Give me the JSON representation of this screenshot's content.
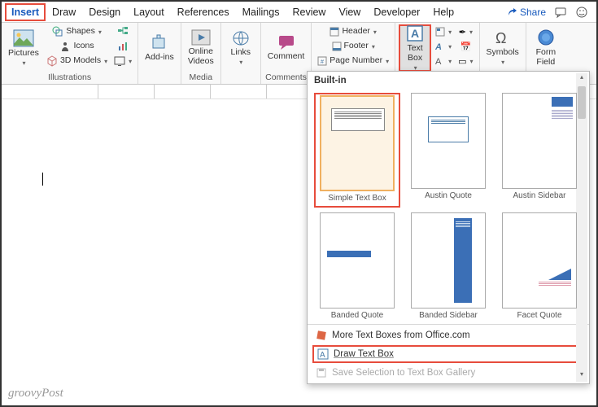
{
  "tabs": {
    "items": [
      "Insert",
      "Draw",
      "Design",
      "Layout",
      "References",
      "Mailings",
      "Review",
      "View",
      "Developer",
      "Help"
    ],
    "active": "Insert"
  },
  "topright": {
    "share": "Share",
    "comments_tooltip": "Comments",
    "smiley_tooltip": "Feedback"
  },
  "ribbon": {
    "illustrations": {
      "label": "Illustrations",
      "pictures": "Pictures",
      "shapes": "Shapes",
      "icons": "Icons",
      "models": "3D Models"
    },
    "addins": {
      "label": "Add-ins",
      "btn": "Add-ins"
    },
    "media": {
      "label": "Media",
      "btn": "Online\nVideos"
    },
    "links": {
      "label": "",
      "btn": "Links"
    },
    "comments": {
      "label": "Comments",
      "btn": "Comment"
    },
    "headerfooter": {
      "header": "Header",
      "footer": "Footer",
      "pagenum": "Page Number"
    },
    "text": {
      "textbox": "Text\nBox"
    },
    "symbols": {
      "label": "Symbols",
      "btn": "Symbols"
    },
    "form": {
      "label": "",
      "btn": "Form\nField"
    }
  },
  "gallery": {
    "header": "Built-in",
    "items": [
      {
        "name": "Simple Text Box"
      },
      {
        "name": "Austin Quote"
      },
      {
        "name": "Austin Sidebar"
      },
      {
        "name": "Banded Quote"
      },
      {
        "name": "Banded Sidebar"
      },
      {
        "name": "Facet Quote"
      }
    ],
    "more": "More Text Boxes from Office.com",
    "draw": "Draw Text Box",
    "save": "Save Selection to Text Box Gallery"
  },
  "watermark": "groovyPost"
}
